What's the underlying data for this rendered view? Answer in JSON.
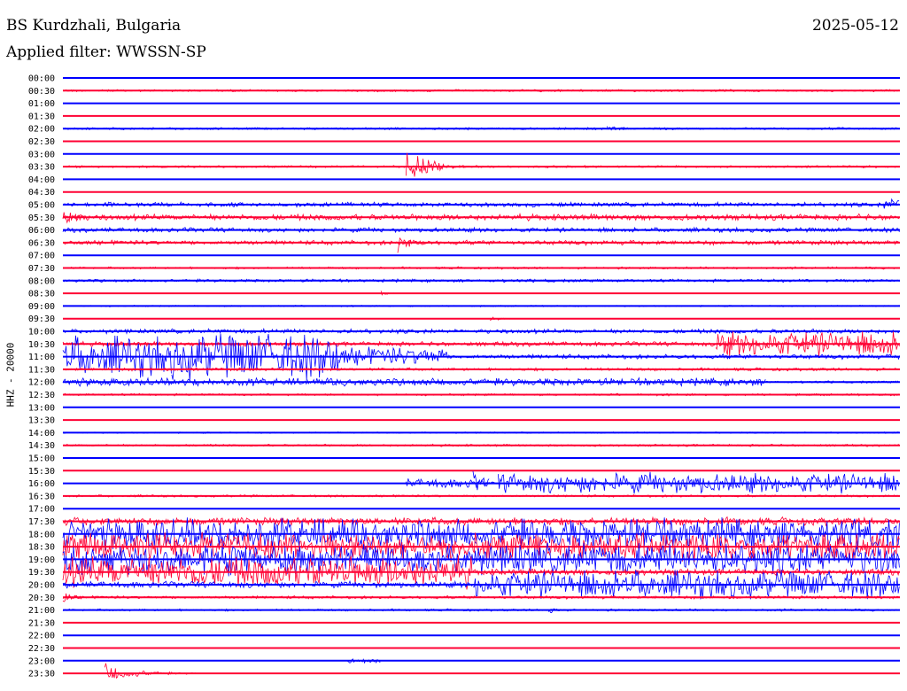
{
  "header": {
    "station": "BS Kurdzhali, Bulgaria",
    "date": "2025-05-12",
    "filter": "Applied filter: WWSSN-SP"
  },
  "channel_label": "HHZ - 20000",
  "colors": {
    "even": "#0000ff",
    "odd": "#ff0033",
    "text": "#000000"
  },
  "chart_data": {
    "type": "line",
    "title": "BS Kurdzhali, Bulgaria",
    "subtitle": "Applied filter: WWSSN-SP",
    "ylabel": "HHZ - 20000",
    "xlabel": "",
    "grid": false,
    "rows": [
      {
        "time": "00:00",
        "events": []
      },
      {
        "time": "00:30",
        "events": [
          {
            "s": 0.0,
            "e": 1.0,
            "a": 1.5
          }
        ]
      },
      {
        "time": "01:00",
        "events": []
      },
      {
        "time": "01:30",
        "events": []
      },
      {
        "time": "02:00",
        "events": [
          {
            "s": 0.0,
            "e": 1.0,
            "a": 1.5
          },
          {
            "s": 0.65,
            "e": 0.72,
            "a": 4,
            "decay": true
          }
        ]
      },
      {
        "time": "02:30",
        "events": []
      },
      {
        "time": "03:00",
        "events": []
      },
      {
        "time": "03:30",
        "events": [
          {
            "s": 0.0,
            "e": 1.0,
            "a": 1.5
          },
          {
            "s": 0.41,
            "e": 0.48,
            "a": 28,
            "decay": true
          }
        ]
      },
      {
        "time": "04:00",
        "events": []
      },
      {
        "time": "04:30",
        "events": []
      },
      {
        "time": "05:00",
        "events": [
          {
            "s": 0.0,
            "e": 1.0,
            "a": 3
          },
          {
            "s": 0.98,
            "e": 1.0,
            "a": 8
          }
        ]
      },
      {
        "time": "05:30",
        "events": [
          {
            "s": 0.0,
            "e": 1.0,
            "a": 4
          },
          {
            "s": 0.0,
            "e": 0.05,
            "a": 14,
            "decay": true
          }
        ]
      },
      {
        "time": "06:00",
        "events": [
          {
            "s": 0.0,
            "e": 1.0,
            "a": 3
          }
        ]
      },
      {
        "time": "06:30",
        "events": [
          {
            "s": 0.0,
            "e": 1.0,
            "a": 3
          },
          {
            "s": 0.4,
            "e": 0.45,
            "a": 14,
            "decay": true
          }
        ]
      },
      {
        "time": "07:00",
        "events": []
      },
      {
        "time": "07:30",
        "events": [
          {
            "s": 0.0,
            "e": 1.0,
            "a": 1.5
          }
        ]
      },
      {
        "time": "08:00",
        "events": [
          {
            "s": 0.0,
            "e": 1.0,
            "a": 2
          }
        ]
      },
      {
        "time": "08:30",
        "events": [
          {
            "s": 0.38,
            "e": 0.4,
            "a": 6,
            "decay": true
          }
        ]
      },
      {
        "time": "09:00",
        "events": [
          {
            "s": 0.0,
            "e": 1.0,
            "a": 1
          }
        ]
      },
      {
        "time": "09:30",
        "events": [
          {
            "s": 0.51,
            "e": 0.55,
            "a": 4,
            "decay": true
          }
        ]
      },
      {
        "time": "10:00",
        "events": [
          {
            "s": 0.0,
            "e": 1.0,
            "a": 3
          }
        ]
      },
      {
        "time": "10:30",
        "events": [
          {
            "s": 0.0,
            "e": 1.0,
            "a": 3
          },
          {
            "s": 0.78,
            "e": 1.0,
            "a": 16
          }
        ]
      },
      {
        "time": "11:00",
        "events": [
          {
            "s": 0.0,
            "e": 0.13,
            "a": 26
          },
          {
            "s": 0.13,
            "e": 0.33,
            "a": 30
          },
          {
            "s": 0.33,
            "e": 0.46,
            "a": 12
          },
          {
            "s": 0.46,
            "e": 1.0,
            "a": 3
          }
        ]
      },
      {
        "time": "11:30",
        "events": [
          {
            "s": 0.0,
            "e": 1.0,
            "a": 2
          }
        ]
      },
      {
        "time": "12:00",
        "events": [
          {
            "s": 0.0,
            "e": 0.84,
            "a": 5
          },
          {
            "s": 0.84,
            "e": 1.0,
            "a": 1.5
          }
        ]
      },
      {
        "time": "12:30",
        "events": [
          {
            "s": 0.0,
            "e": 1.0,
            "a": 1.5
          }
        ]
      },
      {
        "time": "13:00",
        "events": []
      },
      {
        "time": "13:30",
        "events": []
      },
      {
        "time": "14:00",
        "events": [
          {
            "s": 0.0,
            "e": 1.0,
            "a": 1
          }
        ]
      },
      {
        "time": "14:30",
        "events": [
          {
            "s": 0.0,
            "e": 1.0,
            "a": 1.5
          }
        ]
      },
      {
        "time": "15:00",
        "events": []
      },
      {
        "time": "15:30",
        "events": []
      },
      {
        "time": "16:00",
        "events": [
          {
            "s": 0.41,
            "e": 0.51,
            "a": 6
          },
          {
            "s": 0.49,
            "e": 0.52,
            "a": 18,
            "decay": true
          },
          {
            "s": 0.52,
            "e": 1.0,
            "a": 13
          }
        ]
      },
      {
        "time": "16:30",
        "events": [
          {
            "s": 0.0,
            "e": 1.0,
            "a": 1.5
          }
        ]
      },
      {
        "time": "17:00",
        "events": []
      },
      {
        "time": "17:30",
        "events": [
          {
            "s": 0.0,
            "e": 1.0,
            "a": 5
          }
        ]
      },
      {
        "time": "18:00",
        "events": [
          {
            "s": 0.0,
            "e": 1.0,
            "a": 20
          }
        ]
      },
      {
        "time": "18:30",
        "events": [
          {
            "s": 0.0,
            "e": 1.0,
            "a": 18
          }
        ]
      },
      {
        "time": "19:00",
        "events": [
          {
            "s": 0.0,
            "e": 1.0,
            "a": 20
          }
        ]
      },
      {
        "time": "19:30",
        "events": [
          {
            "s": 0.0,
            "e": 0.49,
            "a": 20
          },
          {
            "s": 0.49,
            "e": 1.0,
            "a": 4
          }
        ]
      },
      {
        "time": "20:00",
        "events": [
          {
            "s": 0.0,
            "e": 0.49,
            "a": 4
          },
          {
            "s": 0.49,
            "e": 1.0,
            "a": 18
          }
        ]
      },
      {
        "time": "20:30",
        "events": [
          {
            "s": 0.0,
            "e": 1.0,
            "a": 2
          },
          {
            "s": 0.0,
            "e": 0.04,
            "a": 10,
            "decay": true
          }
        ]
      },
      {
        "time": "21:00",
        "events": [
          {
            "s": 0.0,
            "e": 1.0,
            "a": 1.5
          },
          {
            "s": 0.58,
            "e": 0.61,
            "a": 6,
            "decay": true
          }
        ]
      },
      {
        "time": "21:30",
        "events": []
      },
      {
        "time": "22:00",
        "events": []
      },
      {
        "time": "22:30",
        "events": []
      },
      {
        "time": "23:00",
        "events": [
          {
            "s": 0.34,
            "e": 0.38,
            "a": 3
          }
        ]
      },
      {
        "time": "23:30",
        "events": [
          {
            "s": 0.05,
            "e": 0.16,
            "a": 14,
            "decay": true
          }
        ]
      }
    ]
  }
}
